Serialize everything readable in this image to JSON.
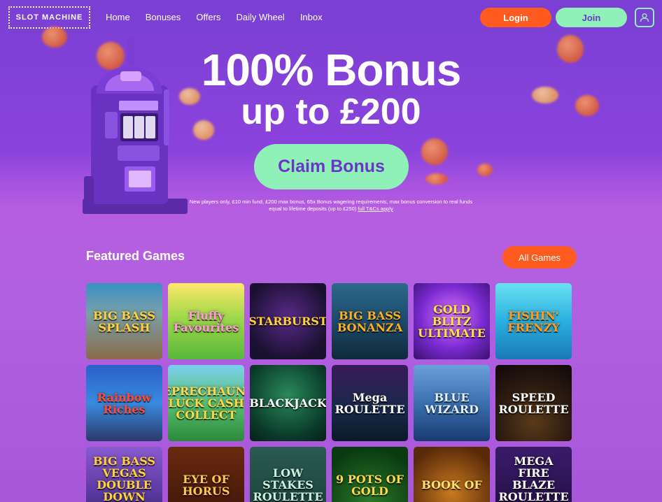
{
  "header": {
    "logo": "SLOT MACHINE",
    "nav": [
      "Home",
      "Bonuses",
      "Offers",
      "Daily Wheel",
      "Inbox"
    ],
    "login_label": "Login",
    "join_label": "Join",
    "account_icon": "user-icon"
  },
  "hero": {
    "title": "100% Bonus",
    "subtitle": "up to £200",
    "claim_label": "Claim Bonus",
    "terms_line1": "New players only, £10 min fund, £200 max bonus, 65x Bonus wagering requirements, max bonus conversion to real funds",
    "terms_line2": "equal to lifetime deposits (up to £250)",
    "terms_link": "full T&Cs apply"
  },
  "featured": {
    "title": "Featured Games",
    "all_games_label": "All Games",
    "games": [
      {
        "name": "BIG BASS SPLASH",
        "bg": "linear-gradient(180deg,#3a8fc4 0%,#7aa0a8 40%,#8a6a48 100%)",
        "color": "#ffd23a"
      },
      {
        "name": "Fluffy Favourites",
        "bg": "linear-gradient(180deg,#ffe86a 0%,#9fd84a 45%,#58b83a 100%)",
        "color": "#ff9ad8"
      },
      {
        "name": "STARBURST",
        "bg": "radial-gradient(circle at 50% 45%,#5a2a8a 0%,#1a1030 75%)",
        "color": "#ffd23a"
      },
      {
        "name": "BIG BASS BONANZA",
        "bg": "linear-gradient(180deg,#2a6a8a 0%,#1e4a6a 50%,#0e2a3a 100%)",
        "color": "#ffb020"
      },
      {
        "name": "GOLD BLITZ ULTIMATE",
        "bg": "radial-gradient(circle at 50% 45%,#e07aff 0%,#7a2ad0 55%,#3a1070 100%)",
        "color": "#ffe24a"
      },
      {
        "name": "FISHIN' FRENZY",
        "bg": "linear-gradient(180deg,#6ae0f0 0%,#2ab0e0 50%,#1a78b8 100%)",
        "color": "#ff9a20"
      },
      {
        "name": "Rainbow Riches",
        "bg": "linear-gradient(180deg,#2a60c8 0%,#3a8ae0 50%,#2a3a6a 100%)",
        "color": "#ff4a3a"
      },
      {
        "name": "LEPRECHAUN'S LUCK CASH COLLECT",
        "bg": "linear-gradient(180deg,#7ad0f0 0%,#5ac070 50%,#2a8a3a 100%)",
        "color": "#ffd84a"
      },
      {
        "name": "BLACKJACK",
        "bg": "radial-gradient(circle at 50% 40%,#2a8a5a 0%,#0a3a2a 70%,#072018 100%)",
        "color": "#ffffff"
      },
      {
        "name": "Mega ROULETTE",
        "bg": "linear-gradient(180deg,#3a1a5a 0%,#1a2a4a 55%,#0a1a2a 100%)",
        "color": "#ffffff"
      },
      {
        "name": "BLUE WIZARD",
        "bg": "linear-gradient(180deg,#6aa0d8 0%,#3a70b0 50%,#1a3a70 100%)",
        "color": "#e0f0ff"
      },
      {
        "name": "SPEED ROULETTE",
        "bg": "radial-gradient(circle at 50% 75%,#5a3a1a 0%,#2a1a10 55%,#10080a 100%)",
        "color": "#ffffff"
      },
      {
        "name": "BIG BASS VEGAS DOUBLE DOWN DELUXE",
        "bg": "linear-gradient(180deg,#8a5ad0 0%,#5a3aa0 60%,#3a2070 100%)",
        "color": "#ffd23a"
      },
      {
        "name": "EYE OF HORUS",
        "bg": "linear-gradient(180deg,#6a2a10 0%,#3a1408 100%)",
        "color": "#ffc84a"
      },
      {
        "name": "LOW STAKES ROULETTE",
        "bg": "linear-gradient(180deg,#2a5a50 0%,#1a4038 100%)",
        "color": "#c8f0e0"
      },
      {
        "name": "9 POTS OF GOLD",
        "bg": "radial-gradient(circle at 50% 70%,#2a7a2a 0%,#0a3a10 80%)",
        "color": "#ffd84a"
      },
      {
        "name": "BOOK OF",
        "bg": "radial-gradient(circle at 50% 60%,#c87a20 0%,#5a2a08 80%)",
        "color": "#ffe070"
      },
      {
        "name": "MEGA FIRE BLAZE ROULETTE LIVE",
        "bg": "linear-gradient(180deg,#3a1a6a 0%,#201040 100%)",
        "color": "#ffffff"
      }
    ]
  }
}
